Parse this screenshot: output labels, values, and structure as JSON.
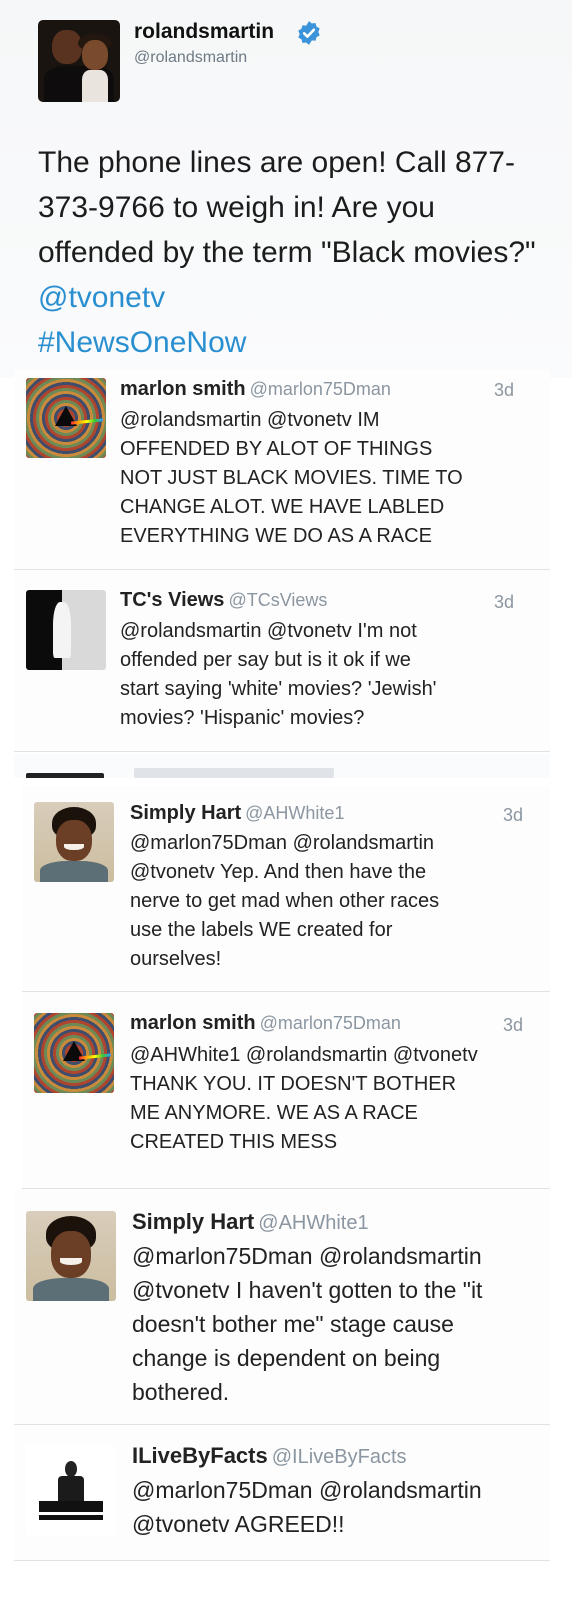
{
  "main_tweet": {
    "name": "rolandsmartin",
    "handle": "@rolandsmartin",
    "verified": true,
    "text": "The phone lines are open! Call 877-373-9766 to weigh in! Are you offended by the term \"Black movies?\" ",
    "mention": "@tvonetv",
    "hashtag": "#NewsOneNow"
  },
  "colors": {
    "link": "#2a8fd0",
    "rule": "#4aa0dd",
    "muted": "#8b96a0"
  },
  "replies": [
    {
      "name": "marlon smith",
      "handle": "@marlon75Dman",
      "time": "3d",
      "text": "@rolandsmartin @tvonetv IM\nOFFENDED BY ALOT OF THINGS\nNOT JUST BLACK MOVIES. TIME TO\nCHANGE ALOT. WE HAVE LABLED\nEVERYTHING WE DO AS A RACE",
      "avatar": "psychedelic-prism-icon"
    },
    {
      "name": "TC's Views",
      "handle": "@TCsViews",
      "time": "3d",
      "text": "@rolandsmartin @tvonetv I'm not\noffended per say but is it ok if we\nstart saying 'white' movies? 'Jewish'\nmovies?  'Hispanic' movies?",
      "avatar": "bw-photo-icon"
    },
    {
      "name": "Simply Hart",
      "handle": "@AHWhite1",
      "time": "3d",
      "text": "@marlon75Dman @rolandsmartin\n@tvonetv Yep. And then have the\nnerve to get mad when other races\nuse the labels WE created for\nourselves!",
      "avatar": "woman-portrait-icon"
    },
    {
      "name": "marlon smith",
      "handle": "@marlon75Dman",
      "time": "3d",
      "text": "@AHWhite1 @rolandsmartin @tvonetv\nTHANK YOU. IT DOESN'T BOTHER\nME ANYMORE. WE AS A RACE\nCREATED THIS MESS",
      "avatar": "psychedelic-prism-icon"
    },
    {
      "name": "Simply Hart",
      "handle": "@AHWhite1",
      "time": "",
      "text": "@marlon75Dman @rolandsmartin\n@tvonetv I haven't gotten to the \"it\ndoesn't bother me\" stage cause\nchange is dependent on being\nbothered.",
      "avatar": "woman-portrait-icon"
    },
    {
      "name": "ILiveByFacts",
      "handle": "@ILiveByFacts",
      "time": "",
      "text": "@marlon75Dman @rolandsmartin\n@tvonetv AGREED!!",
      "avatar": "dj-figure-icon"
    }
  ]
}
